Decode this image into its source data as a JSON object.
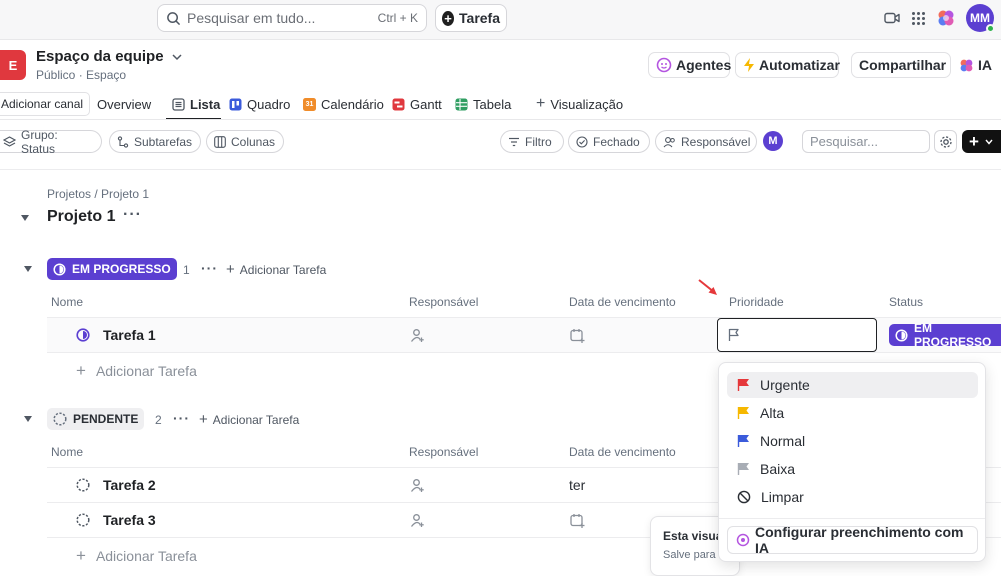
{
  "topbar": {
    "search_placeholder": "Pesquisar em tudo...",
    "search_shortcut": "Ctrl + K",
    "task_button": "Tarefa",
    "avatar_initials": "MM"
  },
  "space": {
    "icon_letter": "E",
    "name": "Espaço da equipe",
    "subtitle": "Público · Espaço",
    "actions": {
      "agents": "Agentes",
      "automate": "Automatizar",
      "share": "Compartilhar",
      "ai": "IA"
    }
  },
  "views": {
    "add_channel": "Adicionar canal",
    "overview": "Overview",
    "lista": "Lista",
    "quadro": "Quadro",
    "calendario": "Calendário",
    "gantt": "Gantt",
    "tabela": "Tabela",
    "add_view": "Visualização",
    "calendar_day": "31"
  },
  "toolbar": {
    "group": "Grupo: Status",
    "subtasks": "Subtarefas",
    "columns": "Colunas",
    "filter": "Filtro",
    "closed": "Fechado",
    "assignee": "Responsável",
    "avatar": "M",
    "search_placeholder": "Pesquisar..."
  },
  "breadcrumb": "Projetos / Projeto 1",
  "list_title": "Projeto 1",
  "columns": {
    "name": "Nome",
    "assignee": "Responsável",
    "due": "Data de vencimento",
    "priority": "Prioridade",
    "status": "Status"
  },
  "groups": [
    {
      "status": "EM PROGRESSO",
      "count": "1",
      "add_label": "Adicionar Tarefa",
      "tasks": [
        {
          "name": "Tarefa 1",
          "status": "EM PROGRESSO"
        }
      ],
      "add_row": "Adicionar Tarefa"
    },
    {
      "status": "PENDENTE",
      "count": "2",
      "add_label": "Adicionar Tarefa",
      "tasks": [
        {
          "name": "Tarefa 2",
          "due": "ter"
        },
        {
          "name": "Tarefa 3"
        }
      ],
      "add_row": "Adicionar Tarefa"
    }
  ],
  "priority_menu": {
    "options": [
      {
        "label": "Urgente",
        "color": "#e5383b"
      },
      {
        "label": "Alta",
        "color": "#f6b800"
      },
      {
        "label": "Normal",
        "color": "#3b5bdb"
      },
      {
        "label": "Baixa",
        "color": "#a8adb5"
      },
      {
        "label": "Limpar"
      }
    ],
    "ai_button": "Configurar preenchimento com IA"
  },
  "tooltip_card": {
    "line1": "Esta visua",
    "line2": "Salve para"
  },
  "colors": {
    "in_progress": "#5b3fd1",
    "accent_red": "#e0383e"
  }
}
